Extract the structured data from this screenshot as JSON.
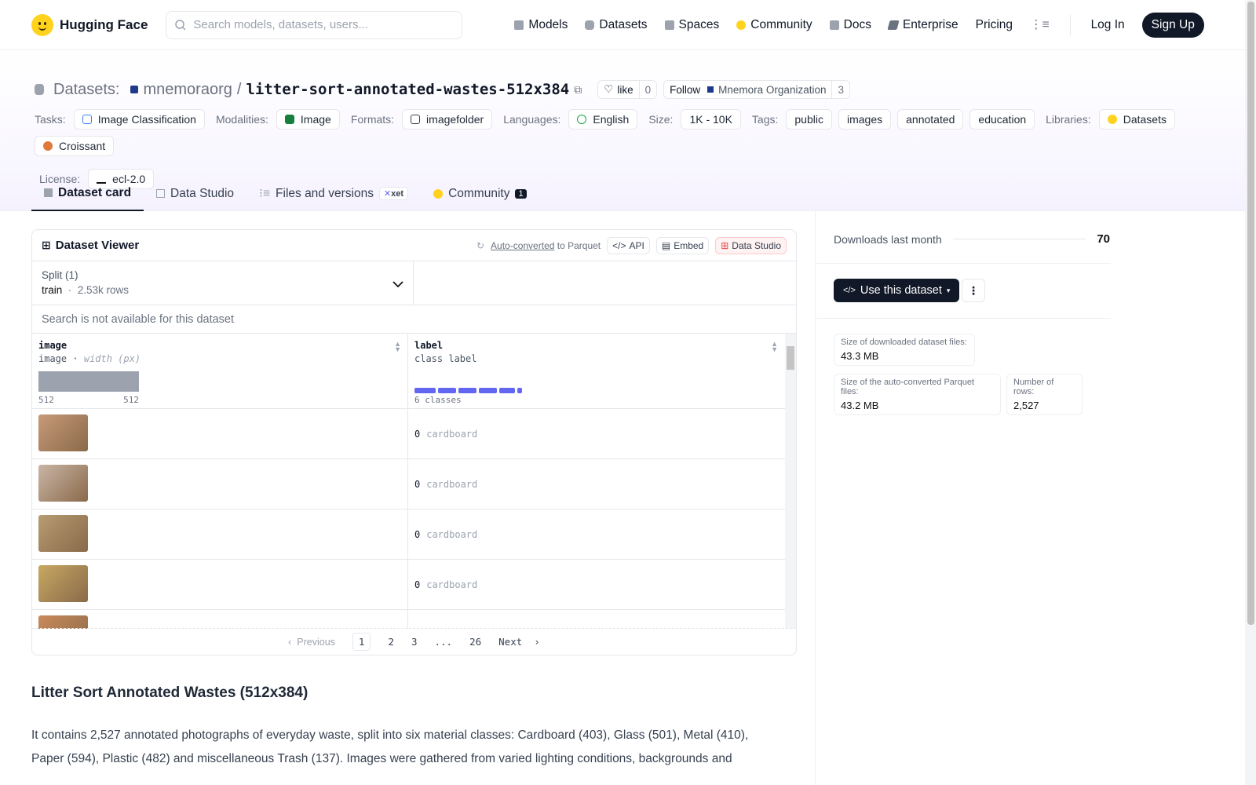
{
  "nav": {
    "brand": "Hugging Face",
    "search_placeholder": "Search models, datasets, users...",
    "links": [
      {
        "label": "Models",
        "icon": "cube-icon",
        "color": "#9ca3af"
      },
      {
        "label": "Datasets",
        "icon": "database-icon",
        "color": "#9ca3af"
      },
      {
        "label": "Spaces",
        "icon": "grid-icon",
        "color": "#9ca3af"
      },
      {
        "label": "Community",
        "icon": "hugging-face-icon",
        "color": "#ffd21e"
      },
      {
        "label": "Docs",
        "icon": "book-icon",
        "color": "#9ca3af"
      },
      {
        "label": "Enterprise",
        "icon": "enterprise-icon",
        "color": "#6b7280"
      }
    ],
    "pricing": "Pricing",
    "login": "Log In",
    "signup": "Sign Up"
  },
  "header": {
    "section": "Datasets:",
    "owner": "mnemoraorg",
    "repo": "litter-sort-annotated-wastes-512x384",
    "like_label": "like",
    "like_count": "0",
    "follow_label": "Follow",
    "org_name": "Mnemora Organization",
    "follower_count": "3",
    "tags": {
      "tasks_label": "Tasks:",
      "task": "Image Classification",
      "modalities_label": "Modalities:",
      "modality": "Image",
      "formats_label": "Formats:",
      "format": "imagefolder",
      "languages_label": "Languages:",
      "language": "English",
      "size_label": "Size:",
      "size": "1K - 10K",
      "tags_label": "Tags:",
      "tag_list": [
        "public",
        "images",
        "annotated",
        "education"
      ],
      "libraries_label": "Libraries:",
      "libraries": [
        "Datasets",
        "Croissant"
      ],
      "license_label": "License:",
      "license": "ecl-2.0"
    },
    "tabs": {
      "card": "Dataset card",
      "studio": "Data Studio",
      "files": "Files and versions",
      "xet": "xet",
      "community": "Community",
      "community_count": "1"
    }
  },
  "viewer": {
    "title": "Dataset Viewer",
    "autoconverted": "Auto-converted",
    "to_parquet": "to Parquet",
    "api": "API",
    "embed": "Embed",
    "data_studio": "Data Studio",
    "split_label": "Split (1)",
    "split_name": "train",
    "split_rows": "2.53k rows",
    "search_notice": "Search is not available for this dataset",
    "columns": {
      "image_name": "image",
      "image_type": "image",
      "image_hint": "width (px)",
      "image_min": "512",
      "image_max": "512",
      "label_name": "label",
      "label_type": "class label",
      "label_classes": "6 classes"
    },
    "rows": [
      {
        "label_id": "0",
        "label_name": "cardboard",
        "thumb_color": "#c79a78"
      },
      {
        "label_id": "0",
        "label_name": "cardboard",
        "thumb_color": "#c9b5a6"
      },
      {
        "label_id": "0",
        "label_name": "cardboard",
        "thumb_color": "#b69c72"
      },
      {
        "label_id": "0",
        "label_name": "cardboard",
        "thumb_color": "#c7a861"
      },
      {
        "label_id": "",
        "label_name": "",
        "thumb_color": "#c98a5a"
      }
    ],
    "pager": {
      "prev": "Previous",
      "pages": [
        "1",
        "2",
        "3",
        "...",
        "26"
      ],
      "next": "Next"
    }
  },
  "card": {
    "title": "Litter Sort Annotated Wastes (512x384)",
    "text": "It contains 2,527 annotated photographs of everyday waste, split into six material classes: Cardboard (403), Glass (501), Metal (410), Paper (594), Plastic (482) and miscellaneous Trash (137). Images were gathered from varied lighting conditions, backgrounds and"
  },
  "sidebar": {
    "downloads_label": "Downloads last month",
    "downloads": "70",
    "use_button": "Use this dataset",
    "stats": [
      {
        "label": "Size of downloaded dataset files:",
        "value": "43.3 MB"
      },
      {
        "label": "Size of the auto-converted Parquet files:",
        "value": "43.2 MB"
      },
      {
        "label": "Number of rows:",
        "value": "2,527"
      }
    ]
  },
  "colors": {
    "accent_dark": "#111827",
    "histogram_blue": "#6366f1",
    "brand_yellow": "#ffd21e"
  }
}
